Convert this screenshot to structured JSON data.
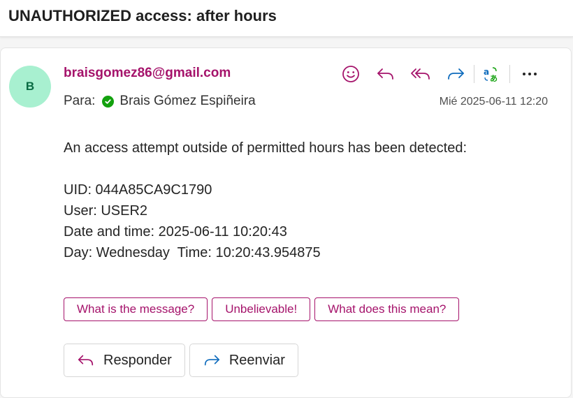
{
  "message": {
    "subject": "UNAUTHORIZED access: after hours",
    "sender": "braisgomez86@gmail.com",
    "avatar_initial": "B",
    "to_label": "Para:",
    "recipient": "Brais Gómez Espiñeira",
    "date": "Mié 2025-06-11 12:20",
    "body": {
      "intro": "An access attempt outside of permitted hours has been detected:",
      "uid": "UID: 044A85CA9C1790",
      "user": "User: USER2",
      "datetime": "Date and time: 2025-06-11 10:20:43",
      "day_time": "Day: Wednesday  Time: 10:20:43.954875"
    }
  },
  "header_actions": [
    "smile-icon",
    "reply-icon",
    "reply-all-icon",
    "forward-icon",
    "translate-icon",
    "more-icon"
  ],
  "suggested_replies": [
    "What is the message?",
    "Unbelievable!",
    "What does this mean?"
  ],
  "reply_buttons": {
    "reply": "Responder",
    "forward": "Reenviar"
  },
  "colors": {
    "accent": "#a5136b",
    "link_blue": "#0f6cbd",
    "avatar_bg": "#a8f0d0",
    "avatar_text": "#0a6b43",
    "presence_green": "#13a10e"
  }
}
